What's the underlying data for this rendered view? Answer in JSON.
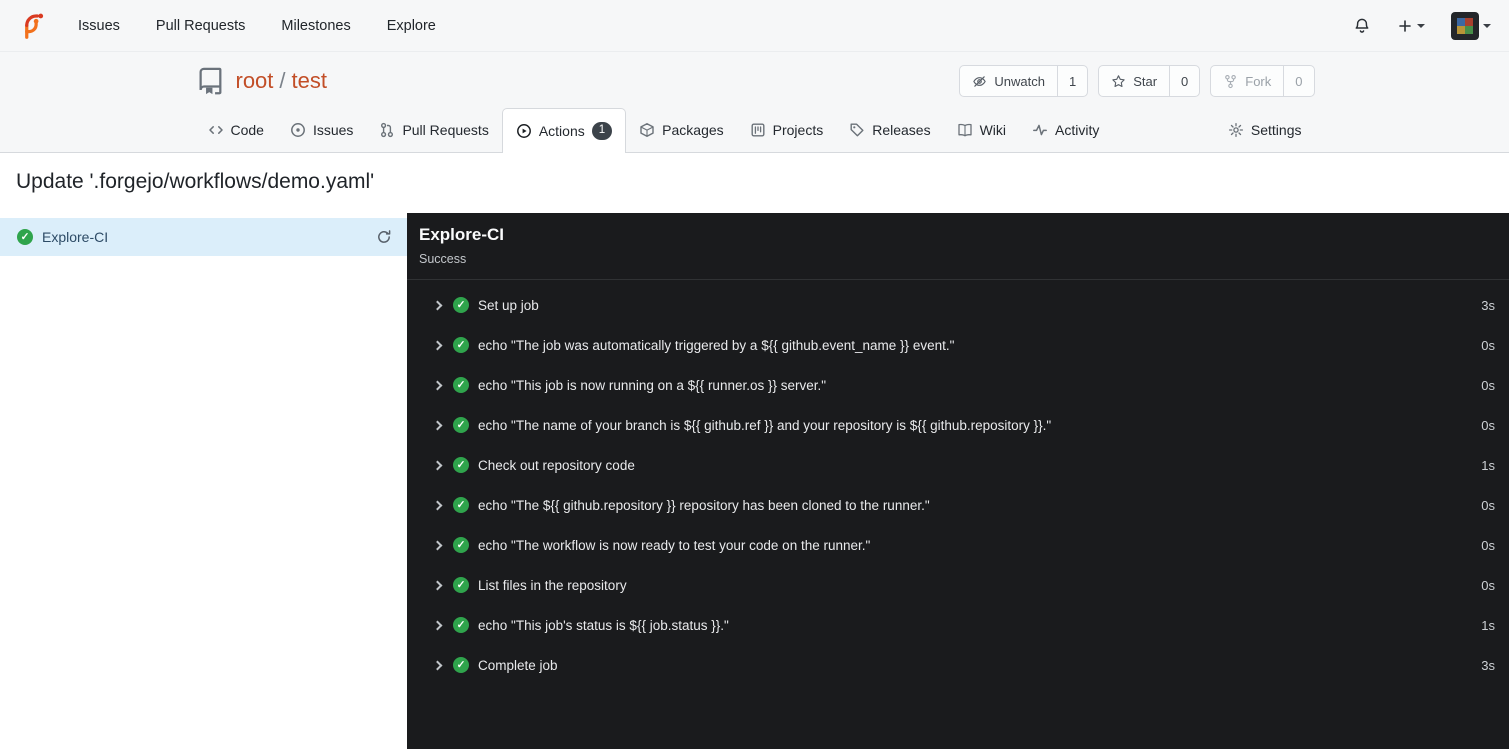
{
  "navbar": {
    "items": [
      "Issues",
      "Pull Requests",
      "Milestones",
      "Explore"
    ]
  },
  "repo_header": {
    "owner": "root",
    "separator": "/",
    "name": "test",
    "buttons": {
      "unwatch_label": "Unwatch",
      "unwatch_count": "1",
      "star_label": "Star",
      "star_count": "0",
      "fork_label": "Fork",
      "fork_count": "0"
    },
    "tabs": [
      {
        "label": "Code"
      },
      {
        "label": "Issues"
      },
      {
        "label": "Pull Requests"
      },
      {
        "label": "Actions",
        "badge": "1"
      },
      {
        "label": "Packages"
      },
      {
        "label": "Projects"
      },
      {
        "label": "Releases"
      },
      {
        "label": "Wiki"
      },
      {
        "label": "Activity"
      },
      {
        "label": "Settings"
      }
    ]
  },
  "run": {
    "title": "Update '.forgejo/workflows/demo.yaml'"
  },
  "sidebar": {
    "jobs": [
      {
        "name": "Explore-CI",
        "status": "success"
      }
    ]
  },
  "panel": {
    "job_name": "Explore-CI",
    "status": "Success",
    "steps": [
      {
        "name": "Set up job",
        "duration": "3s"
      },
      {
        "name": "echo \"The job was automatically triggered by a ${{ github.event_name }} event.\"",
        "duration": "0s"
      },
      {
        "name": "echo \"This job is now running on a ${{ runner.os }} server.\"",
        "duration": "0s"
      },
      {
        "name": "echo \"The name of your branch is ${{ github.ref }} and your repository is ${{ github.repository }}.\"",
        "duration": "0s"
      },
      {
        "name": "Check out repository code",
        "duration": "1s"
      },
      {
        "name": "echo \"The ${{ github.repository }} repository has been cloned to the runner.\"",
        "duration": "0s"
      },
      {
        "name": "echo \"The workflow is now ready to test your code on the runner.\"",
        "duration": "0s"
      },
      {
        "name": "List files in the repository",
        "duration": "0s"
      },
      {
        "name": "echo \"This job's status is ${{ job.status }}.\"",
        "duration": "1s"
      },
      {
        "name": "Complete job",
        "duration": "3s"
      }
    ]
  },
  "icons": [
    "forgejo-logo",
    "bell-icon",
    "plus-icon",
    "caret-down-icon",
    "avatar",
    "repo-icon",
    "eye-off-icon",
    "star-icon",
    "fork-icon",
    "code-icon",
    "issue-icon",
    "pull-request-icon",
    "play-circle-icon",
    "package-icon",
    "projects-icon",
    "tag-icon",
    "book-icon",
    "activity-icon",
    "gear-icon",
    "check-circle-icon",
    "chevron-right-icon",
    "sync-icon"
  ],
  "colors": {
    "accent": "#c24e27",
    "success_green": "#2fa44c",
    "selected_job_bg": "#dbeefa",
    "console_bg": "#1a1b1d",
    "header_bg": "#f6f7f8",
    "badge_bg": "#3c434a"
  }
}
